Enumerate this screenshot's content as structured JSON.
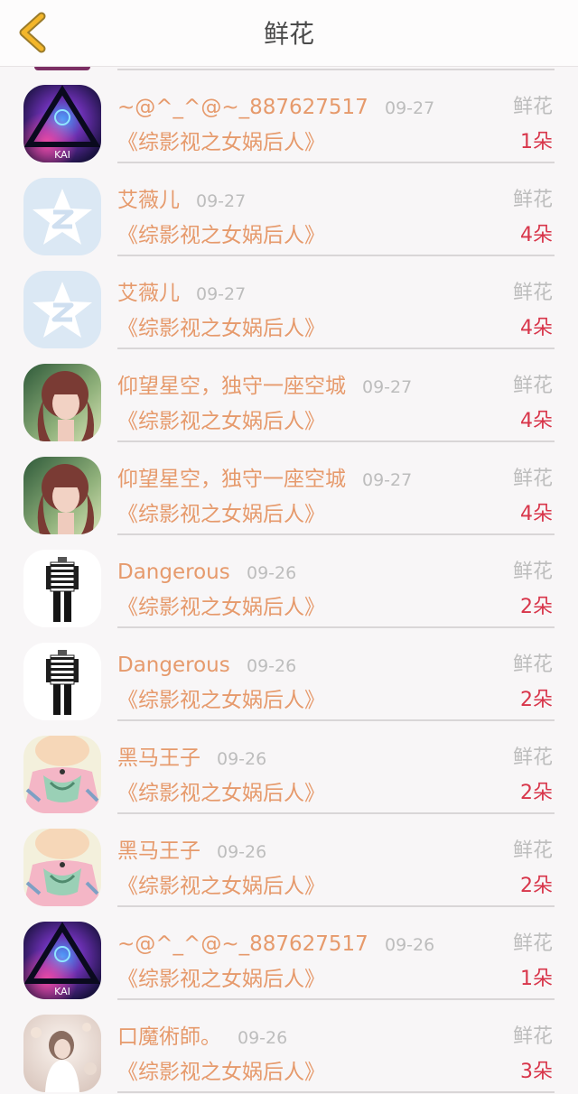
{
  "header": {
    "title": "鲜花",
    "back_icon": "chevron-left-icon",
    "back_color": "#f1b225"
  },
  "flower_label": "鲜花",
  "items": [
    {
      "name": "~@^_^@~_887627517",
      "date": "09-27",
      "book": "《综影视之女娲后人》",
      "count": "1朵",
      "avatar": "galaxy-triangle"
    },
    {
      "name": "艾薇儿",
      "date": "09-27",
      "book": "《综影视之女娲后人》",
      "count": "4朵",
      "avatar": "qzone-star"
    },
    {
      "name": "艾薇儿",
      "date": "09-27",
      "book": "《综影视之女娲后人》",
      "count": "4朵",
      "avatar": "qzone-star"
    },
    {
      "name": "仰望星空，独守一座空城",
      "date": "09-27",
      "book": "《综影视之女娲后人》",
      "count": "4朵",
      "avatar": "girl-portrait"
    },
    {
      "name": "仰望星空，独守一座空城",
      "date": "09-27",
      "book": "《综影视之女娲后人》",
      "count": "4朵",
      "avatar": "girl-portrait"
    },
    {
      "name": "Dangerous",
      "date": "09-26",
      "book": "《综影视之女娲后人》",
      "count": "2朵",
      "avatar": "striped-figure"
    },
    {
      "name": "Dangerous",
      "date": "09-26",
      "book": "《综影视之女娲后人》",
      "count": "2朵",
      "avatar": "striped-figure"
    },
    {
      "name": "黑马王子",
      "date": "09-26",
      "book": "《综影视之女娲后人》",
      "count": "2朵",
      "avatar": "anime-character"
    },
    {
      "name": "黑马王子",
      "date": "09-26",
      "book": "《综影视之女娲后人》",
      "count": "2朵",
      "avatar": "anime-character"
    },
    {
      "name": "~@^_^@~_887627517",
      "date": "09-26",
      "book": "《综影视之女娲后人》",
      "count": "1朵",
      "avatar": "galaxy-triangle"
    },
    {
      "name": "口魔術師。",
      "date": "09-26",
      "book": "《综影视之女娲后人》",
      "count": "3朵",
      "avatar": "girl-light"
    }
  ],
  "colors": {
    "name": "#e69a6c",
    "count": "#d8354a",
    "muted": "#bdbdbd"
  }
}
